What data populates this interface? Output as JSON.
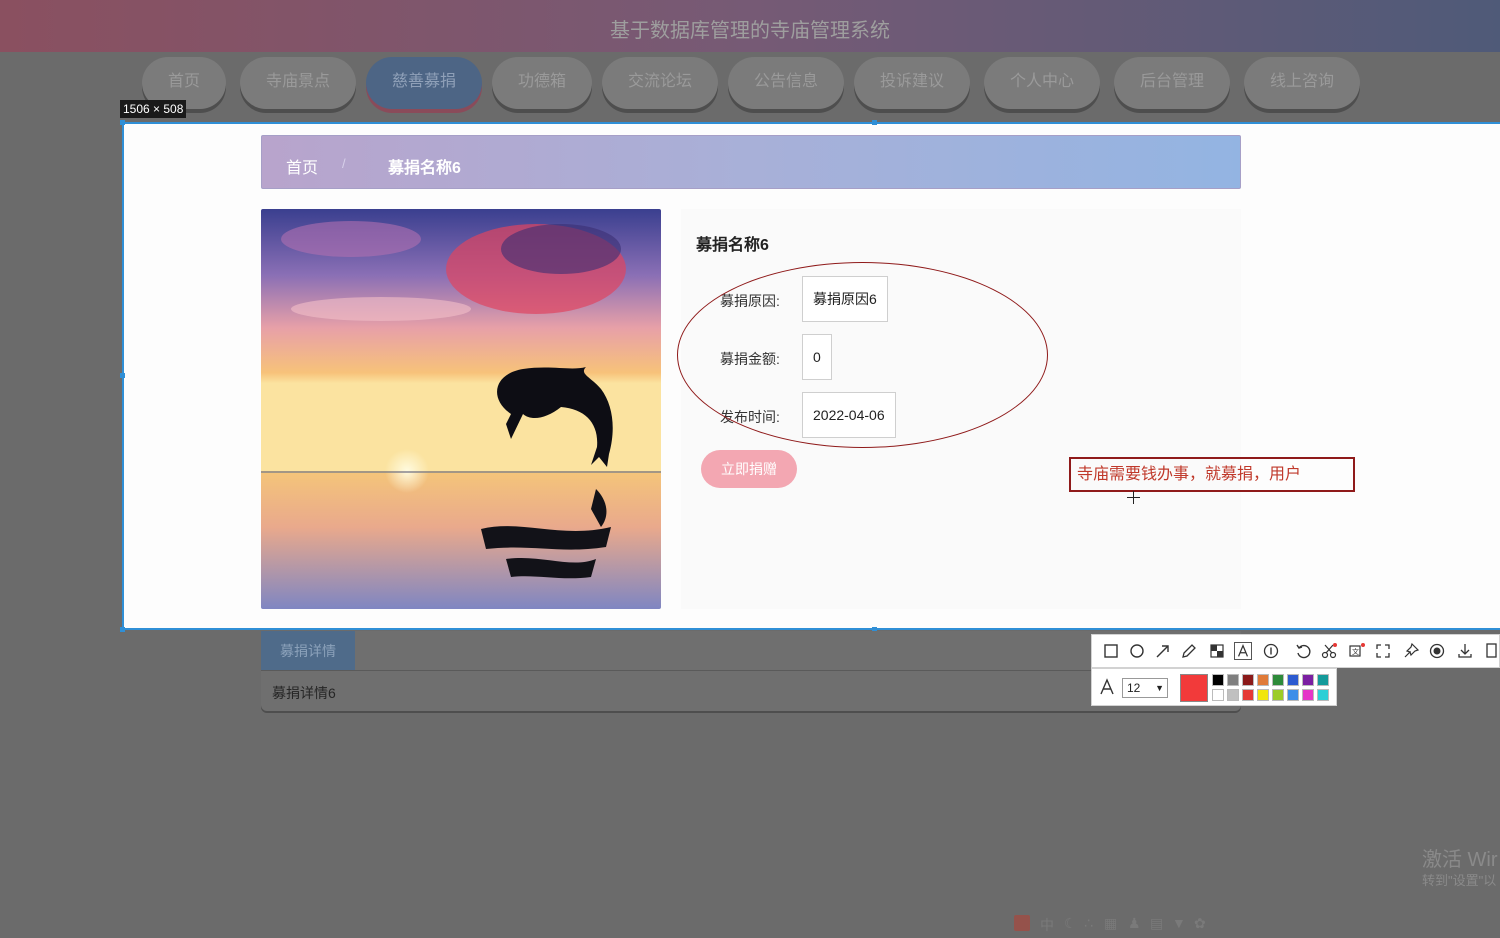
{
  "header": {
    "title": "基于数据库管理的寺庙管理系统"
  },
  "nav": {
    "items": [
      "首页",
      "寺庙景点",
      "慈善募捐",
      "功德箱",
      "交流论坛",
      "公告信息",
      "投诉建议",
      "个人中心",
      "后台管理",
      "线上咨询"
    ],
    "active": "慈善募捐"
  },
  "selection": {
    "size_label": "1506 × 508"
  },
  "breadcrumb": {
    "home": "首页",
    "sep": "/",
    "current": "募捐名称6"
  },
  "detail": {
    "name": "募捐名称6",
    "reason_label": "募捐原因:",
    "reason_value": "募捐原因6",
    "amount_label": "募捐金额:",
    "amount_value": "0",
    "date_label": "发布时间:",
    "date_value": "2022-04-06",
    "donate_button": "立即捐赠"
  },
  "annotation": {
    "text": "寺庙需要钱办事，就募捐，用户",
    "color": "#c0392b"
  },
  "details_tab": {
    "tab_label": "募捐详情",
    "content": "募捐详情6"
  },
  "screenshot_toolbar": {
    "tools": [
      "rectangle-icon",
      "ellipse-icon",
      "arrow-icon",
      "pencil-icon",
      "mosaic-icon",
      "text-icon",
      "number-icon",
      "undo-icon",
      "cut-icon",
      "ocr-icon",
      "fullscreen-icon",
      "pin-icon",
      "record-icon",
      "download-icon",
      "copy-icon"
    ],
    "font_size": "12",
    "current_color": "#f23a3a",
    "palette": [
      "#000000",
      "#7f7f7f",
      "#8b1a1a",
      "#e07b39",
      "#2e8b3a",
      "#2d5bd0",
      "#7b1fa2",
      "#159a9a",
      "#ffffff",
      "#c0c0c0",
      "#e53935",
      "#f1e60c",
      "#9ccc28",
      "#3c8ee8",
      "#e535c8",
      "#2ccfd6"
    ]
  },
  "watermark": {
    "line1": "激活 Wir",
    "line2": "转到\"设置\"以"
  },
  "tray": {
    "ime": "中"
  }
}
